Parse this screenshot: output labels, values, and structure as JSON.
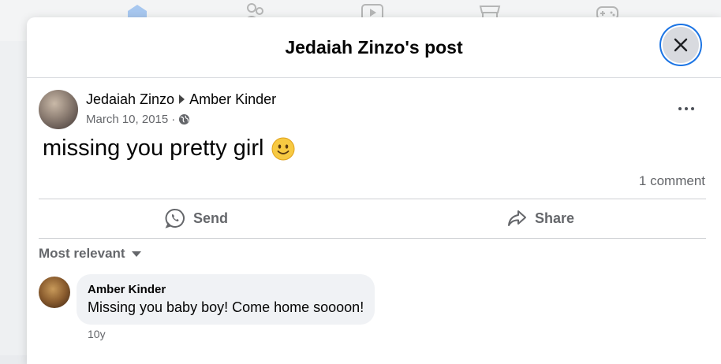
{
  "modal": {
    "title": "Jedaiah Zinzo's post"
  },
  "post": {
    "author": "Jedaiah Zinzo",
    "recipient": "Amber Kinder",
    "date": "March 10, 2015",
    "separator": "·",
    "audience_icon": "globe-icon",
    "text": "missing you pretty girl",
    "emoji": "slightly-smiling-face",
    "comment_count": "1 comment"
  },
  "actions": {
    "send_label": "Send",
    "share_label": "Share"
  },
  "comments": {
    "sort_label": "Most relevant",
    "items": [
      {
        "author": "Amber Kinder",
        "text": "Missing you baby boy! Come home soooon!",
        "time": "10y"
      }
    ]
  },
  "colors": {
    "focus_ring": "#1b74e4",
    "secondary_text": "#65676b",
    "bubble_bg": "#f0f2f5"
  }
}
